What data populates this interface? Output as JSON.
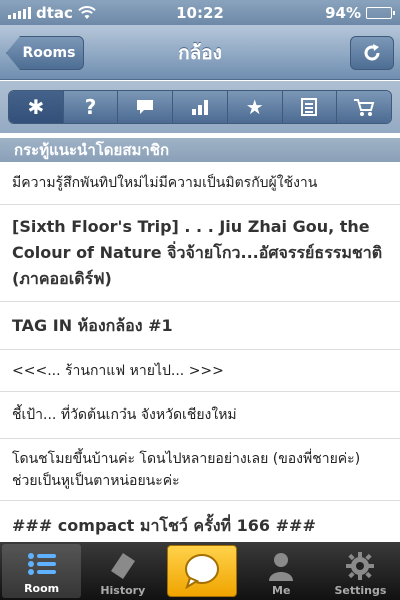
{
  "status_bar": {
    "carrier": "dtac",
    "time": "10:22",
    "battery": "94%",
    "battery_level": 0.94
  },
  "nav": {
    "back_label": "Rooms",
    "title": "กล้อง"
  },
  "toolbar": {
    "segments": [
      {
        "icon": "asterisk-icon",
        "glyph": "✱"
      },
      {
        "icon": "help-icon",
        "glyph": "?"
      },
      {
        "icon": "comment-icon",
        "glyph": ""
      },
      {
        "icon": "stats-icon",
        "glyph": ""
      },
      {
        "icon": "star-icon",
        "glyph": "★"
      },
      {
        "icon": "document-icon",
        "glyph": ""
      },
      {
        "icon": "cart-icon",
        "glyph": ""
      }
    ]
  },
  "section_header": "กระทู้แนะนำโดยสมาชิก",
  "topics": [
    "มีความรู้สึกพันทิปใหม่ไม่มีความเป็นมิตรกับผู้ใช้งาน",
    "[Sixth Floor's Trip] . . . Jiu Zhai Gou, the Colour of Nature จิ่วจ้ายโกว...อัศจรรย์ธรรมชาติ (ภาคออเดิร์ฟ)",
    "TAG IN  ห้องกล้อง #1",
    "<<<... ร้านกาแฟ หายไป... >>>",
    "ชี้เป้า... ที่วัดต้นเกว๋น จังหวัดเชียงใหม่",
    "โดนชโมยขึ้นบ้านค่ะ โดนไปหลายอย่างเลย (ของพี่ชายค่ะ) ช่วยเป็นหูเป็นตาหน่อยนะค่ะ",
    "### compact มาโชว์ ครั้งที่ 166 ###"
  ],
  "tabs": [
    {
      "label": "Room",
      "icon": "list-icon"
    },
    {
      "label": "History",
      "icon": "tag-icon"
    },
    {
      "label": "",
      "icon": "speech-bubble-icon"
    },
    {
      "label": "Me",
      "icon": "person-icon"
    },
    {
      "label": "Settings",
      "icon": "gear-icon"
    }
  ],
  "colors": {
    "nav_blue": "#6f8eb0",
    "accent_yellow": "#f0a400"
  }
}
